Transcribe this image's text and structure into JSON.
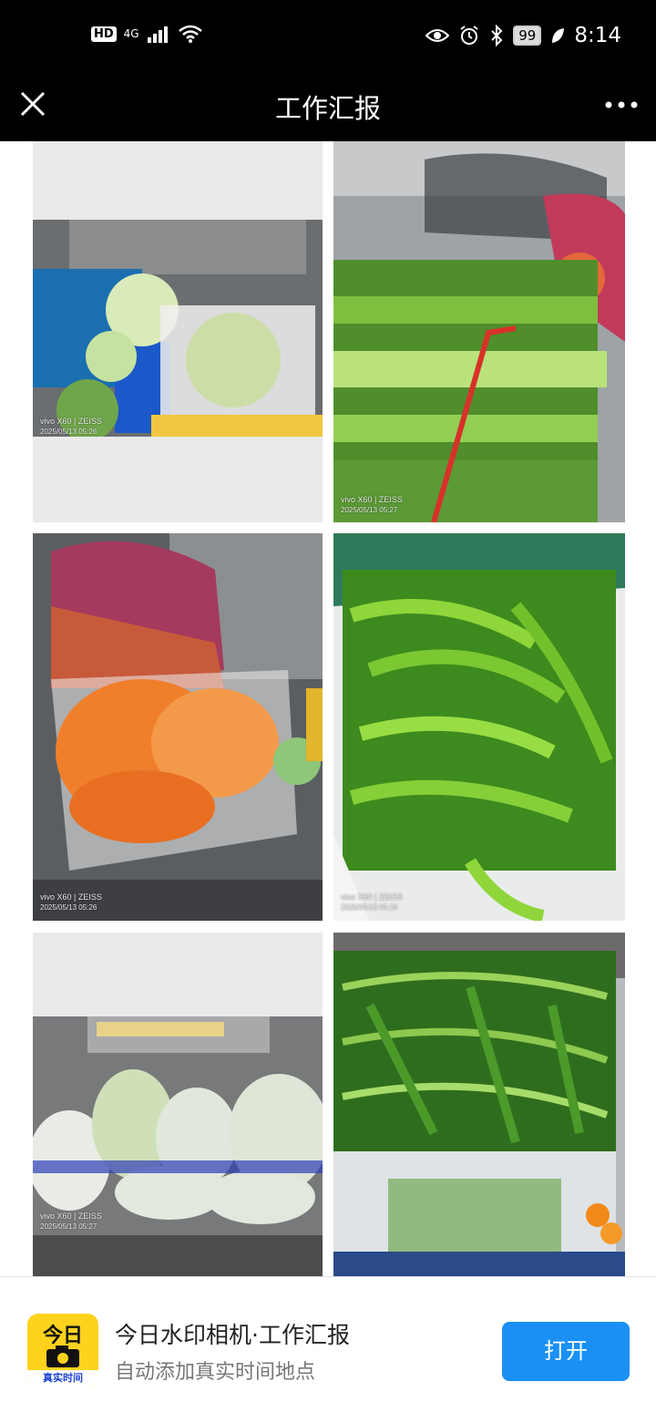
{
  "status_bar": {
    "left": {
      "hd": "HD",
      "network": "4G"
    },
    "right": {
      "battery": "99",
      "time": "8:14"
    }
  },
  "title_bar": {
    "title": "工作汇报"
  },
  "photos": [
    {
      "name": "cabbage",
      "brand": "vivo X60 | ZEISS",
      "timestamp": "2025/05/13 05:26"
    },
    {
      "name": "chives",
      "brand": "vivo X60 | ZEISS",
      "timestamp": "2025/05/13 05:27"
    },
    {
      "name": "carrots",
      "brand": "vivo X60 | ZEISS",
      "timestamp": "2025/05/13 05:26"
    },
    {
      "name": "green-peppers",
      "brand": "vivo X60 | ZEISS",
      "timestamp": "2025/05/13 05:26"
    },
    {
      "name": "bagged-vegetables",
      "brand": "vivo X60 | ZEISS",
      "timestamp": "2025/05/13 05:27"
    },
    {
      "name": "water-spinach",
      "brand": "",
      "timestamp": ""
    }
  ],
  "banner": {
    "icon_top": "今日",
    "icon_bottom": "真实时间",
    "title": "今日水印相机·工作汇报",
    "subtitle": "自动添加真实时间地点",
    "open_button": "打开",
    "accent_color": "#1a90f4"
  }
}
